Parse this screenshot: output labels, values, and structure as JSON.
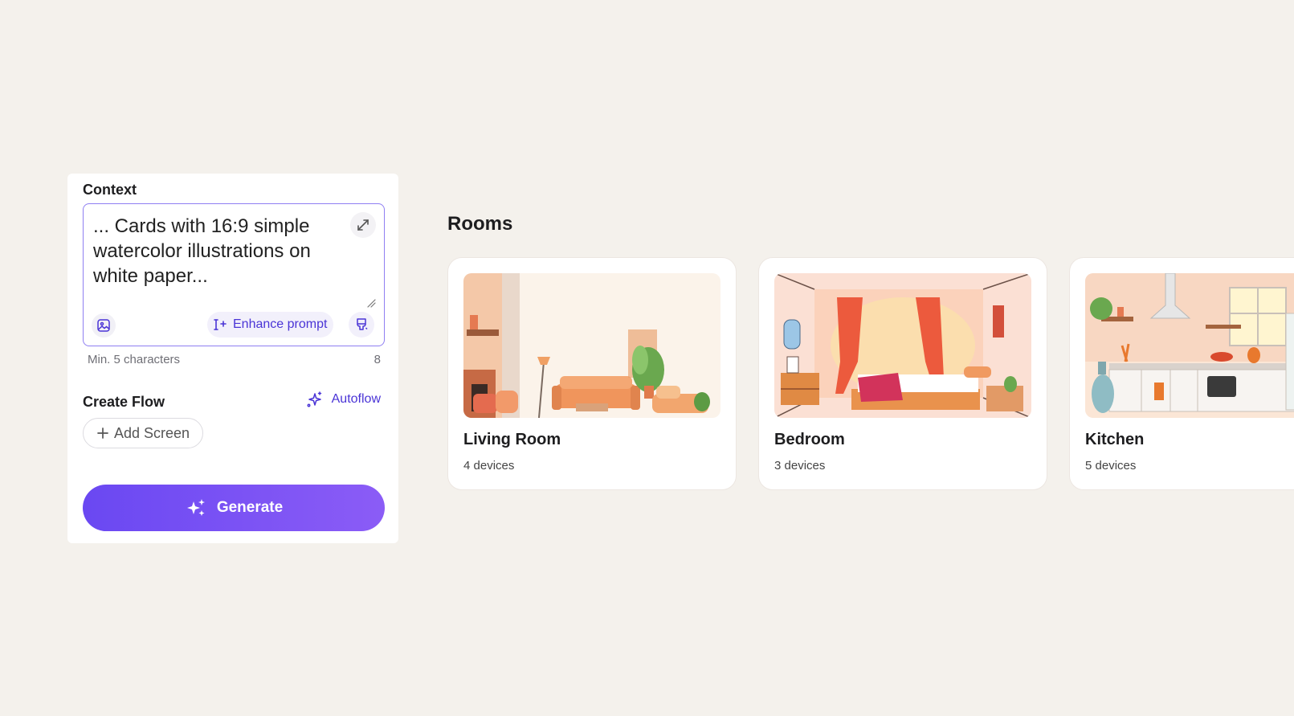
{
  "context": {
    "label": "Context",
    "prompt_text": "... Cards with 16:9 simple watercolor illustrations on white paper...",
    "enhance_label": "Enhance prompt",
    "hint": "Min. 5 characters",
    "count": "8"
  },
  "flow": {
    "label": "Create Flow",
    "autoflow_label": "Autoflow",
    "add_screen_label": "Add Screen"
  },
  "generate_label": "Generate",
  "rooms": {
    "title": "Rooms",
    "cards": [
      {
        "name": "Living Room",
        "devices": "4 devices"
      },
      {
        "name": "Bedroom",
        "devices": "3 devices"
      },
      {
        "name": "Kitchen",
        "devices": "5 devices"
      }
    ]
  },
  "colors": {
    "background": "#f4f1ec",
    "accent": "#4a34d6",
    "generate_start": "#6a48f2",
    "generate_end": "#8b5cf6"
  }
}
